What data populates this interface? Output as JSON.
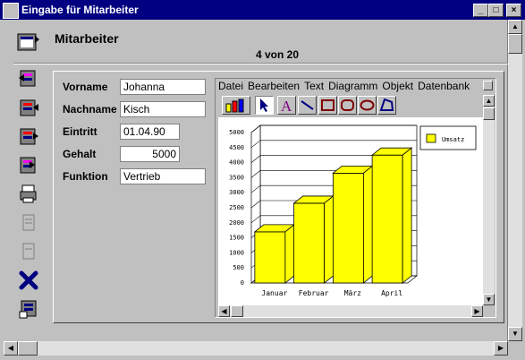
{
  "window": {
    "title": "Eingabe für Mitarbeiter"
  },
  "header": {
    "title": "Mitarbeiter",
    "record_counter": "4 von 20"
  },
  "form": {
    "vorname": {
      "label": "Vorname",
      "value": "Johanna"
    },
    "nachname": {
      "label": "Nachname",
      "value": "Kisch"
    },
    "eintritt": {
      "label": "Eintritt",
      "value": "01.04.90"
    },
    "gehalt": {
      "label": "Gehalt",
      "value": "5000"
    },
    "funktion": {
      "label": "Funktion",
      "value": "Vertrieb"
    }
  },
  "chart_window": {
    "menu": [
      "Datei",
      "Bearbeiten",
      "Text",
      "Diagramm",
      "Objekt",
      "Datenbank"
    ]
  },
  "colors": {
    "bar_fill": "#ffff00",
    "title_bar": "#000080",
    "bevel": "#c0c0c0"
  },
  "chart_data": {
    "type": "bar",
    "categories": [
      "Januar",
      "Februar",
      "März",
      "April"
    ],
    "series": [
      {
        "name": "Umsatz",
        "values": [
          1700,
          2650,
          3650,
          4250
        ]
      }
    ],
    "ylim": [
      0,
      5000
    ],
    "yticks": [
      "5000",
      "4500",
      "4000",
      "3500",
      "3000",
      "2500",
      "2000",
      "1500",
      "1000",
      "500",
      "0"
    ],
    "legend": "top-right",
    "grid": true,
    "style": "3d"
  }
}
